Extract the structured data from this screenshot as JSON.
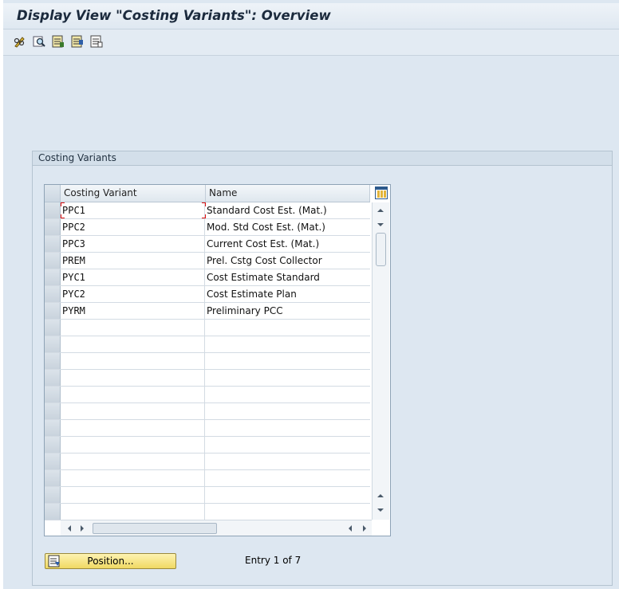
{
  "window": {
    "title": "Display View \"Costing Variants\": Overview"
  },
  "toolbar": {
    "icons": [
      "glasses-edit-icon",
      "search-icon",
      "select-all-icon",
      "select-block-icon",
      "deselect-all-icon"
    ]
  },
  "group": {
    "title": "Costing Variants"
  },
  "table": {
    "columns": [
      "Costing Variant",
      "Name"
    ],
    "rows": [
      {
        "variant": "PPC1",
        "name": "Standard Cost Est. (Mat.)"
      },
      {
        "variant": "PPC2",
        "name": "Mod. Std Cost Est. (Mat.)"
      },
      {
        "variant": "PPC3",
        "name": "Current Cost Est. (Mat.)"
      },
      {
        "variant": "PREM",
        "name": "Prel. Cstg Cost Collector"
      },
      {
        "variant": "PYC1",
        "name": "Cost Estimate Standard"
      },
      {
        "variant": "PYC2",
        "name": "Cost Estimate Plan"
      },
      {
        "variant": "PYRM",
        "name": "Preliminary PCC"
      }
    ],
    "empty_row_count": 12
  },
  "footer": {
    "position_button": "Position...",
    "entry_text": "Entry 1 of 7"
  }
}
